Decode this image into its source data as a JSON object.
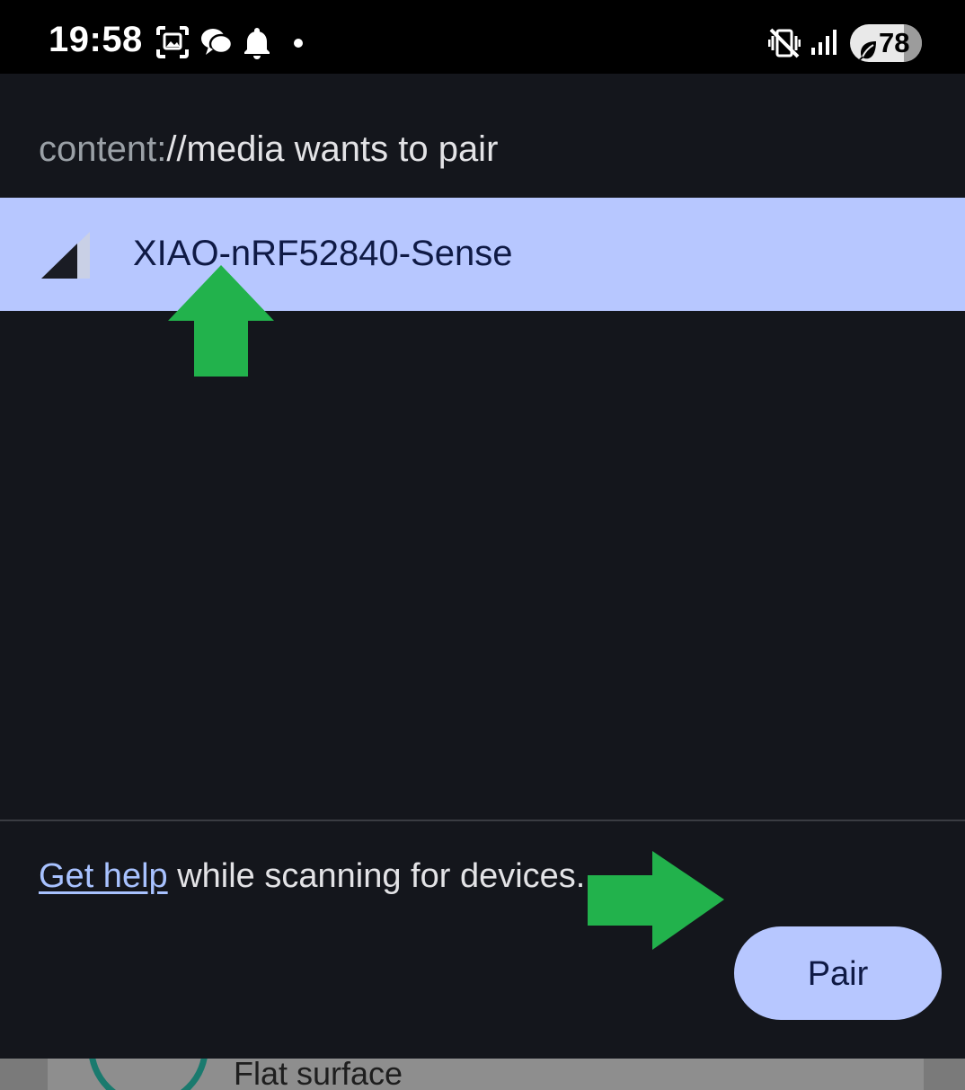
{
  "status_bar": {
    "time": "19:58",
    "icons": [
      "screenshot-icon",
      "chat-bubbles-icon",
      "bell-icon",
      "dot-icon",
      "vibrate-icon",
      "signal-bars-icon",
      "battery-saver-leaf-icon"
    ],
    "battery_percent": "78"
  },
  "dialog": {
    "title_prefix": "content:",
    "title_rest": "//media wants to pair",
    "devices": [
      {
        "name": "XIAO-nRF52840-Sense",
        "icon": "signal-strength-icon",
        "selected": true
      }
    ],
    "help_link": "Get help",
    "help_text": " while scanning for devices...",
    "pair_button": "Pair"
  },
  "annotations": {
    "arrow_color": "#22b24c",
    "arrows": [
      "arrow-up-icon",
      "arrow-right-icon"
    ]
  },
  "background_app": {
    "label": "Flat surface"
  },
  "colors": {
    "dialog_bg": "#14161c",
    "accent": "#b7c7ff",
    "accent_text": "#0f1a45",
    "link": "#a8c2ff"
  }
}
